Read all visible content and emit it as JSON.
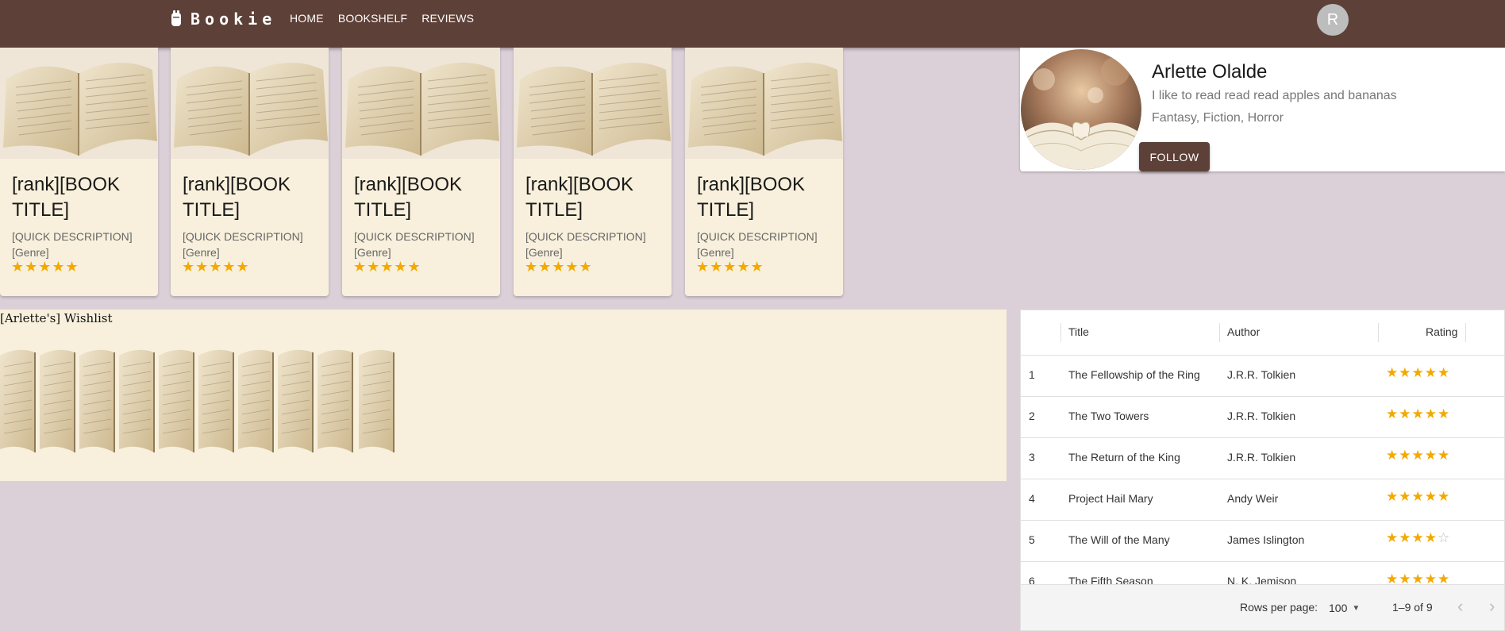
{
  "app": {
    "logo_text": "Bookie",
    "nav": [
      "HOME",
      "BOOKSHELF",
      "REVIEWS"
    ],
    "avatar_initial": "R"
  },
  "cards": [
    {
      "title": "[rank][BOOK TITLE]",
      "description": "[QUICK DESCRIPTION]",
      "genre": "[Genre]",
      "rating": 5
    },
    {
      "title": "[rank][BOOK TITLE]",
      "description": "[QUICK DESCRIPTION]",
      "genre": "[Genre]",
      "rating": 5
    },
    {
      "title": "[rank][BOOK TITLE]",
      "description": "[QUICK DESCRIPTION]",
      "genre": "[Genre]",
      "rating": 5
    },
    {
      "title": "[rank][BOOK TITLE]",
      "description": "[QUICK DESCRIPTION]",
      "genre": "[Genre]",
      "rating": 5
    },
    {
      "title": "[rank][BOOK TITLE]",
      "description": "[QUICK DESCRIPTION]",
      "genre": "[Genre]",
      "rating": 5
    }
  ],
  "profile": {
    "name": "Arlette Olalde",
    "bio": "I like to read read read apples and bananas",
    "genres": "Fantasy, Fiction, Horror",
    "follow_label": "FOLLOW"
  },
  "wishlist": {
    "title": "[Arlette's] Wishlist",
    "book_count": 10
  },
  "table": {
    "headers": {
      "title": "Title",
      "author": "Author",
      "rating": "Rating"
    },
    "rows": [
      {
        "rank": "1",
        "title": "The Fellowship of the Ring",
        "author": "J.R.R. Tolkien",
        "rating": 5
      },
      {
        "rank": "2",
        "title": "The Two Towers",
        "author": "J.R.R. Tolkien",
        "rating": 5
      },
      {
        "rank": "3",
        "title": "The Return of the King",
        "author": "J.R.R. Tolkien",
        "rating": 5
      },
      {
        "rank": "4",
        "title": "Project Hail Mary",
        "author": "Andy Weir",
        "rating": 5
      },
      {
        "rank": "5",
        "title": "The Will of the Many",
        "author": "James Islington",
        "rating": 4
      },
      {
        "rank": "6",
        "title": "The Fifth Season",
        "author": "N. K. Jemison",
        "rating": 5
      }
    ],
    "footer": {
      "rows_per_page_label": "Rows per page:",
      "rows_per_page_value": "100",
      "range": "1–9 of 9"
    }
  },
  "colors": {
    "appbar": "#5d4037",
    "background": "#dcd0d8",
    "card": "#f8f0dc",
    "star": "#f2a900"
  }
}
